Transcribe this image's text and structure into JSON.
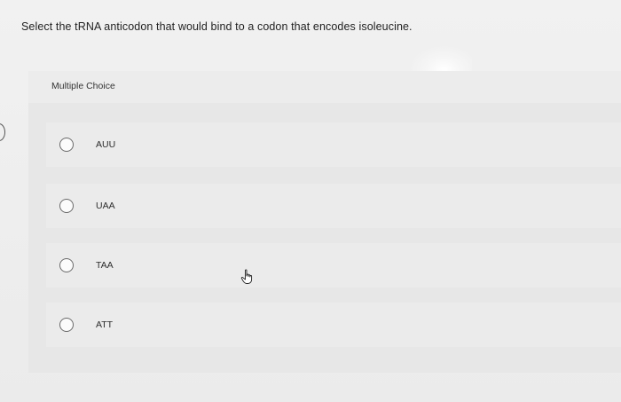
{
  "question": {
    "text": "Select the tRNA anticodon that would bind to a codon that encodes isoleucine."
  },
  "panel": {
    "label": "Multiple Choice",
    "options": [
      {
        "label": "AUU",
        "selected": false
      },
      {
        "label": "UAA",
        "selected": false
      },
      {
        "label": "TAA",
        "selected": false
      },
      {
        "label": "ATT",
        "selected": false
      }
    ]
  },
  "cursor": {
    "icon": "hand-pointer-icon"
  },
  "colors": {
    "background": "#ebebeb",
    "panel": "#e7e7e7",
    "radio_border": "#6a6a6a"
  }
}
